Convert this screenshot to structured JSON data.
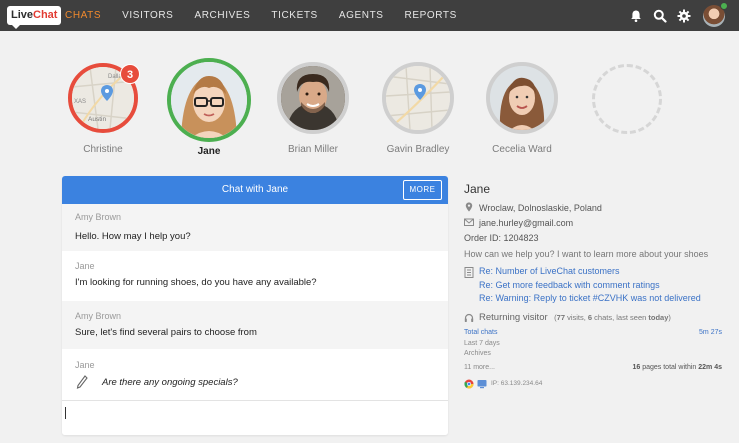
{
  "nav": {
    "logo_a": "Live",
    "logo_b": "Chat",
    "items": [
      "CHATS",
      "VISITORS",
      "ARCHIVES",
      "TICKETS",
      "AGENTS",
      "REPORTS"
    ]
  },
  "bubbles": [
    {
      "name": "Christine",
      "badge": "3",
      "map_labels": [
        "Dalla",
        "XAS",
        "Austin"
      ]
    },
    {
      "name": "Jane"
    },
    {
      "name": "Brian Miller"
    },
    {
      "name": "Gavin Bradley"
    },
    {
      "name": "Cecelia Ward"
    }
  ],
  "chat": {
    "title": "Chat with Jane",
    "more_label": "MORE",
    "messages": [
      {
        "author": "Amy Brown",
        "text": "Hello. How may I help you?"
      },
      {
        "author": "Jane",
        "text": "I'm looking for running shoes, do you have any available?"
      },
      {
        "author": "Amy Brown",
        "text": "Sure, let's find several pairs to choose from"
      },
      {
        "author": "Jane",
        "text": "Are there any ongoing specials?"
      }
    ]
  },
  "visitor": {
    "name": "Jane",
    "location": "Wroclaw, Dolnoslaskie, Poland",
    "email": "jane.hurley@gmail.com",
    "order": "Order ID: 1204823",
    "question": "How can we help you? I want to learn more about your shoes",
    "tickets": [
      "Re: Number of LiveChat customers",
      "Re: Get more feedback with comment ratings",
      "Re: Warning: Reply to ticket #CZVHK was not delivered"
    ],
    "returning_label": "Returning visitor",
    "returning_open": "(",
    "visits": "77",
    "visits_label": " visits, ",
    "chats": "6",
    "chats_label": " chats, last seen ",
    "last_seen": "today",
    "returning_close": ")",
    "total_chats_label": "Total chats",
    "total_chats_value": "5m 27s",
    "last7_label": "Last 7 days",
    "archives_label": "Archives",
    "more_label": "11 more...",
    "pages_count": "16",
    "pages_label": " pages total within ",
    "pages_time": "22m 4s",
    "ip": "IP: 63.139.234.64"
  },
  "colors": {
    "accent": "#f0892d",
    "chat_header": "#3b82e0",
    "link": "#3b72c6",
    "active_ring": "#4caf50",
    "waiting_ring": "#e74c3c"
  }
}
